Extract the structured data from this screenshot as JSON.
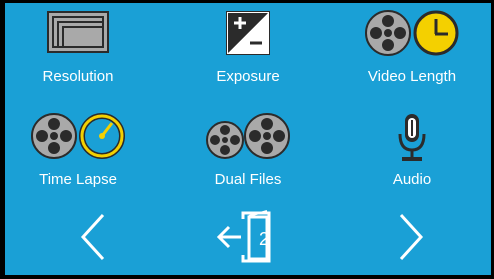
{
  "theme": {
    "background": "#1aa0d6",
    "foreground": "#ffffff",
    "icon_dark": "#2b2b2b",
    "icon_gray": "#a9a9a9",
    "accent_yellow": "#f4d000"
  },
  "menu": {
    "items": [
      {
        "label": "Resolution",
        "icon": "resolution-icon"
      },
      {
        "label": "Exposure",
        "icon": "exposure-icon"
      },
      {
        "label": "Video Length",
        "icon": "video-length-icon"
      },
      {
        "label": "Time Lapse",
        "icon": "time-lapse-icon"
      },
      {
        "label": "Dual Files",
        "icon": "dual-files-icon"
      },
      {
        "label": "Audio",
        "icon": "microphone-icon"
      }
    ]
  },
  "nav": {
    "prev_icon": "chevron-left-icon",
    "exit_icon": "exit-door-icon",
    "next_icon": "chevron-right-icon",
    "page_number": "2"
  }
}
